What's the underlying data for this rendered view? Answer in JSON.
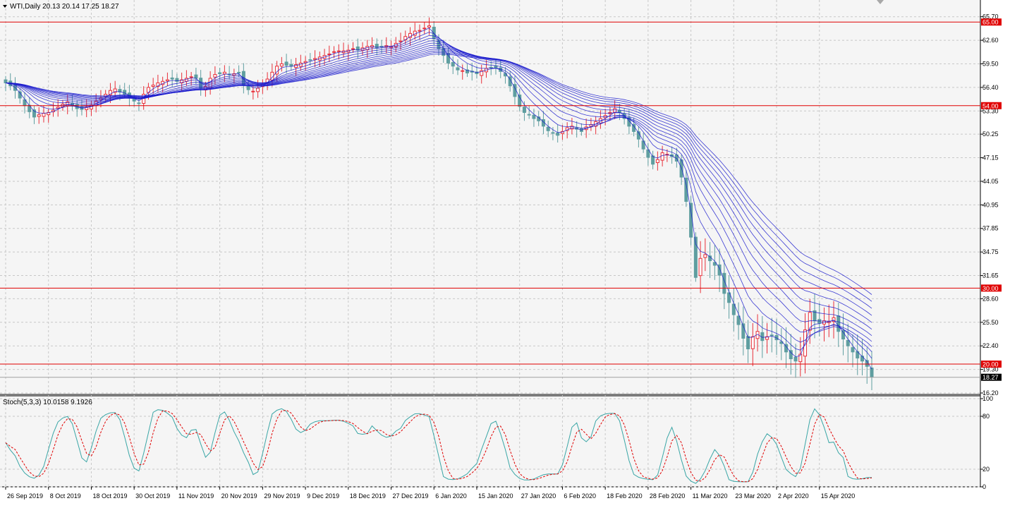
{
  "header": {
    "symbol": "WTI,Daily",
    "ohlc": "20.13 20.14 17.25 18.27"
  },
  "stoch": {
    "label": "Stoch(5,3,3) 10.0158 9.1926"
  },
  "colors": {
    "bg": "#f5f5f5",
    "grid": "#c8c8c8",
    "up": "#e8303a",
    "down": "#5f9ea0",
    "ribbon": "#1a1acc",
    "levels": "#e00000",
    "k": "#3aa6a6",
    "d": "#e00000"
  },
  "chart_data": [
    {
      "type": "candlestick",
      "y_ticks": [
        "65.70",
        "62.60",
        "59.50",
        "56.40",
        "53.30",
        "50.25",
        "47.15",
        "44.05",
        "40.95",
        "37.85",
        "34.75",
        "31.65",
        "28.60",
        "25.50",
        "22.40",
        "19.30",
        "16.20"
      ],
      "ylim": [
        16.2,
        66.6
      ],
      "x_ticks": [
        "26 Sep 2019",
        "8 Oct 2019",
        "18 Oct 2019",
        "30 Oct 2019",
        "11 Nov 2019",
        "20 Nov 2019",
        "29 Nov 2019",
        "9 Dec 2019",
        "18 Dec 2019",
        "27 Dec 2019",
        "6 Jan 2020",
        "15 Jan 2020",
        "27 Jan 2020",
        "6 Feb 2020",
        "18 Feb 2020",
        "28 Feb 2020",
        "11 Mar 2020",
        "23 Mar 2020",
        "2 Apr 2020",
        "15 Apr 2020"
      ],
      "x_tick_index": [
        0,
        9,
        18,
        27,
        36,
        45,
        54,
        63,
        72,
        81,
        90,
        99,
        108,
        117,
        126,
        135,
        144,
        153,
        162,
        171
      ],
      "levels": [
        {
          "value": 65.0,
          "label": "65.00"
        },
        {
          "value": 54.0,
          "label": "54.00"
        },
        {
          "value": 30.0,
          "label": "30.00"
        },
        {
          "value": 20.0,
          "label": "20.00"
        }
      ],
      "current_price": {
        "value": 18.27,
        "label": "18.27"
      },
      "close": [
        57,
        56.6,
        56,
        55,
        54,
        53.2,
        52.5,
        52.8,
        53,
        53.1,
        53.4,
        53.8,
        54.2,
        54.5,
        54,
        53.6,
        53.5,
        53.8,
        54.1,
        54.6,
        55,
        55.5,
        56,
        56.2,
        55.8,
        55.5,
        55,
        54.6,
        54.3,
        55.5,
        56.4,
        56.7,
        57,
        57.2,
        57.4,
        57.5,
        57.2,
        57.4,
        57.6,
        57.8,
        57.6,
        56.3,
        56.5,
        57.6,
        58.1,
        58.2,
        58.4,
        58.1,
        58.2,
        58.3,
        56.7,
        56.1,
        55.9,
        56.3,
        56.8,
        57.5,
        58.4,
        59.2,
        59.5,
        59.3,
        59.2,
        59.4,
        59.6,
        59.8,
        60,
        60.2,
        60.4,
        60.6,
        60.8,
        61.1,
        61.2,
        61.2,
        61.3,
        61.5,
        61.3,
        61.6,
        61.8,
        61.9,
        61.6,
        61.8,
        61.9,
        61.8,
        62.2,
        62.5,
        63.1,
        63.5,
        63.8,
        63.9,
        64.2,
        64.5,
        62.8,
        61.5,
        60.6,
        59.6,
        59.2,
        58.7,
        58.6,
        58.3,
        58.4,
        58.2,
        58.6,
        58.9,
        59,
        59,
        58.5,
        57.9,
        56.6,
        55.2,
        53.9,
        53.1,
        52.8,
        52.3,
        52,
        51.3,
        50.7,
        50.4,
        50.1,
        50.6,
        51.1,
        51.3,
        50.9,
        50.6,
        51.2,
        51.5,
        51.9,
        52.3,
        52.7,
        53.1,
        53.6,
        53.1,
        52.3,
        51.3,
        50.6,
        49.6,
        48.3,
        47.2,
        46.3,
        46.9,
        47.8,
        47.6,
        47.3,
        46.7,
        44.6,
        41.4,
        36.7,
        31.4,
        33.9,
        34.4,
        33.6,
        33,
        31.7,
        29.3,
        28.1,
        26.5,
        25.2,
        23.4,
        22,
        23.6,
        24.3,
        23.1,
        23.6,
        23.8,
        23.2,
        22.7,
        21.6,
        20.7,
        20.4,
        21.3,
        24.5,
        26.8,
        25.7,
        25.4,
        25.7,
        25.6,
        26.1,
        24.3,
        23.3,
        22.4,
        21.6,
        20.8,
        20.4,
        19.7,
        18.3
      ],
      "series_count": 12
    },
    {
      "type": "line",
      "y_ticks": [
        "100",
        "80",
        "20",
        "0"
      ],
      "ylim": [
        0,
        100
      ]
    }
  ]
}
